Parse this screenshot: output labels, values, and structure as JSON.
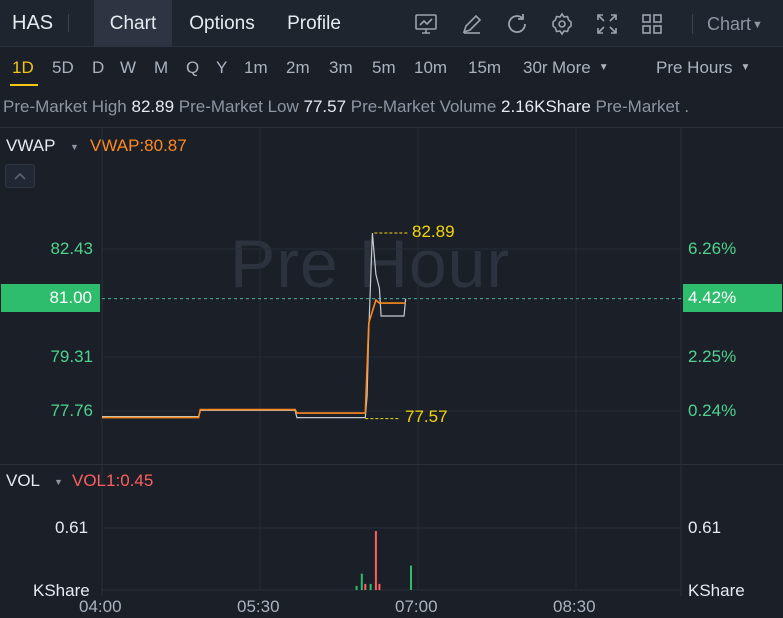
{
  "header": {
    "ticker": "HAS",
    "tabs": [
      {
        "label": "Chart",
        "active": true
      },
      {
        "label": "Options",
        "active": false
      },
      {
        "label": "Profile",
        "active": false
      }
    ],
    "toolbar_icons": [
      "chart-icon",
      "draw-icon",
      "refresh-icon",
      "settings-icon",
      "fullscreen-icon",
      "grid-icon"
    ],
    "chart_type_label": "Chart"
  },
  "periods": {
    "items": [
      "1D",
      "5D",
      "D",
      "W",
      "M",
      "Q",
      "Y",
      "1m",
      "2m",
      "3m",
      "5m",
      "10m",
      "15m",
      "30r"
    ],
    "active": "1D",
    "more_label": "More",
    "session_label": "Pre Hours"
  },
  "stats": {
    "high_label": "Pre-Market High",
    "high_value": "82.89",
    "low_label": "Pre-Market Low",
    "low_value": "77.57",
    "volume_label": "Pre-Market Volume",
    "volume_value": "2.16KShare",
    "extra_label": "Pre-Market ."
  },
  "main_chart": {
    "indicator_name": "VWAP",
    "indicator_value": "VWAP:80.87",
    "watermark": "Pre Hour",
    "current_price": "81.00",
    "current_pct": "4.42%",
    "y_left": [
      "82.43",
      "79.31",
      "77.76"
    ],
    "y_right": [
      "6.26%",
      "2.25%",
      "0.24%"
    ],
    "high_label": "82.89",
    "low_label": "77.57"
  },
  "volume_chart": {
    "indicator_name": "VOL",
    "indicator_value": "VOL1:0.45",
    "y_left": "0.61",
    "y_right": "0.61",
    "unit_left": "KShare",
    "unit_right": "KShare"
  },
  "x_axis": [
    "04:00",
    "05:30",
    "07:00",
    "08:30"
  ],
  "colors": {
    "background": "#1a1f28",
    "up": "#2ebd6c",
    "down": "#ff5f5f",
    "vwap": "#ff8a1f",
    "price_line": "#c8ccd2",
    "high_low": "#f5d60a",
    "active_period": "#f5c518"
  },
  "chart_data": {
    "type": "line",
    "series": [
      {
        "name": "VWAP",
        "points": [
          [
            "04:00",
            77.57
          ],
          [
            "04:55",
            77.57
          ],
          [
            "04:56",
            77.8
          ],
          [
            "05:50",
            77.8
          ],
          [
            "05:51",
            77.7
          ],
          [
            "06:30",
            77.7
          ],
          [
            "06:32",
            80.3
          ],
          [
            "06:36",
            80.96
          ],
          [
            "06:38",
            80.87
          ],
          [
            "06:53",
            80.87
          ]
        ]
      },
      {
        "name": "Price",
        "points": [
          [
            "04:00",
            77.6
          ],
          [
            "04:55",
            77.6
          ],
          [
            "04:56",
            77.78
          ],
          [
            "05:50",
            77.78
          ],
          [
            "05:51",
            77.57
          ],
          [
            "06:30",
            77.57
          ],
          [
            "06:31",
            78.2
          ],
          [
            "06:32",
            80.1
          ],
          [
            "06:34",
            82.89
          ],
          [
            "06:36",
            81.7
          ],
          [
            "06:38",
            81.3
          ],
          [
            "06:39",
            80.5
          ],
          [
            "06:52",
            80.5
          ],
          [
            "06:53",
            81.0
          ]
        ]
      },
      {
        "name": "VOL1",
        "points": [
          [
            "06:25",
            0.04
          ],
          [
            "06:28",
            0.16
          ],
          [
            "06:30",
            0.06
          ],
          [
            "06:33",
            0.06
          ],
          [
            "06:36",
            0.58
          ],
          [
            "06:38",
            0.06
          ],
          [
            "06:56",
            0.24
          ]
        ]
      }
    ],
    "ylim": [
      76.5,
      84.5
    ],
    "current": 81.0,
    "high": 82.89,
    "low": 77.57,
    "x_ticks": [
      "04:00",
      "05:30",
      "07:00",
      "08:30"
    ]
  }
}
